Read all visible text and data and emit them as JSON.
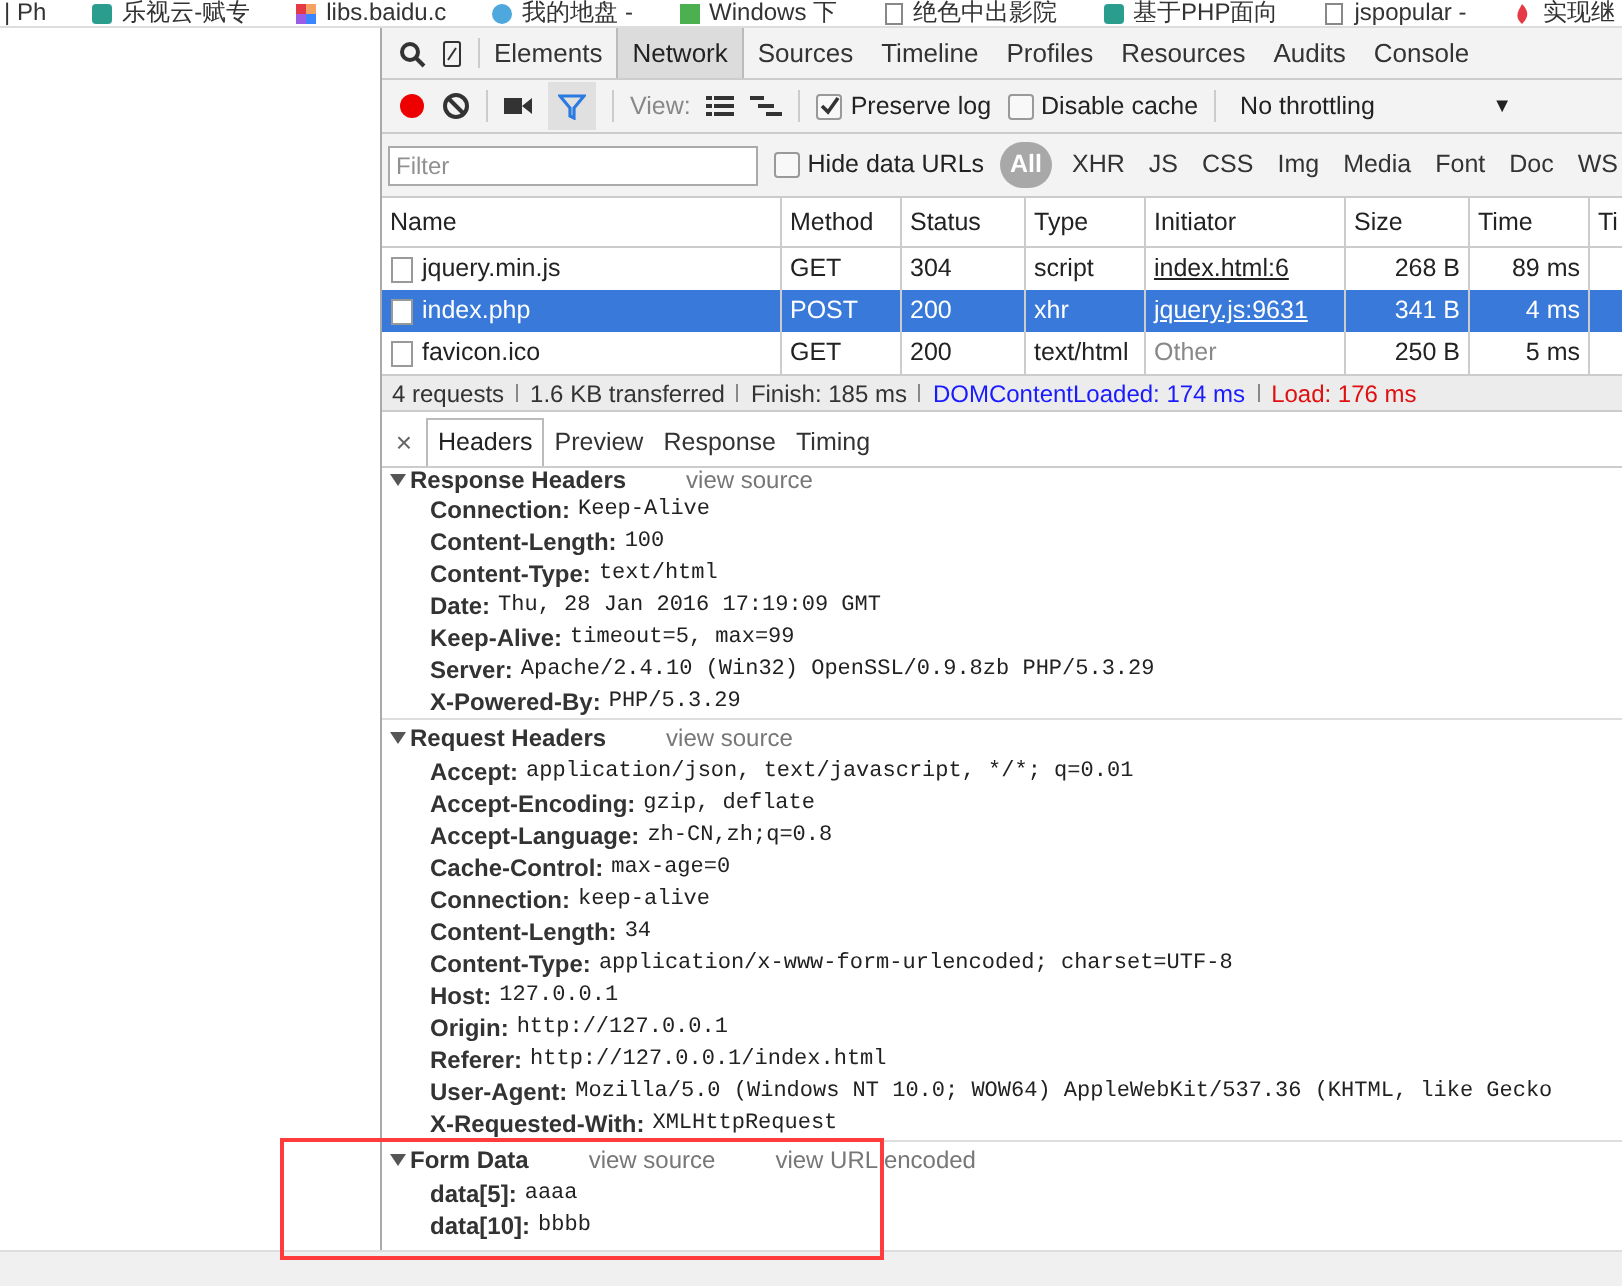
{
  "bookmarks": [
    {
      "label": "| Ph"
    },
    {
      "label": "乐视云-赋专"
    },
    {
      "label": "libs.baidu.c"
    },
    {
      "label": "我的地盘 -"
    },
    {
      "label": "Windows 下"
    },
    {
      "label": "绝色中出影院"
    },
    {
      "label": "基于PHP面向"
    },
    {
      "label": "jspopular -"
    },
    {
      "label": "实现继"
    }
  ],
  "panel_tabs": [
    {
      "label": "Elements",
      "selected": false
    },
    {
      "label": "Network",
      "selected": true
    },
    {
      "label": "Sources",
      "selected": false
    },
    {
      "label": "Timeline",
      "selected": false
    },
    {
      "label": "Profiles",
      "selected": false
    },
    {
      "label": "Resources",
      "selected": false
    },
    {
      "label": "Audits",
      "selected": false
    },
    {
      "label": "Console",
      "selected": false
    }
  ],
  "toolbar": {
    "recording": true,
    "filter_on": true,
    "view_label": "View:",
    "preserve_log": {
      "label": "Preserve log",
      "checked": true
    },
    "disable_cache": {
      "label": "Disable cache",
      "checked": false
    },
    "throttling": "No throttling",
    "throttle_caret": "▼"
  },
  "filter_bar": {
    "placeholder": "Filter",
    "hide_data_urls": {
      "label": "Hide data URLs",
      "checked": false
    },
    "types": [
      {
        "label": "All",
        "selected": true
      },
      {
        "label": "XHR",
        "selected": false
      },
      {
        "label": "JS",
        "selected": false
      },
      {
        "label": "CSS",
        "selected": false
      },
      {
        "label": "Img",
        "selected": false
      },
      {
        "label": "Media",
        "selected": false
      },
      {
        "label": "Font",
        "selected": false
      },
      {
        "label": "Doc",
        "selected": false
      },
      {
        "label": "WS",
        "selected": false
      }
    ]
  },
  "table": {
    "columns": [
      "Name",
      "Method",
      "Status",
      "Type",
      "Initiator",
      "Size",
      "Time",
      "Ti"
    ],
    "rows": [
      {
        "name": "jquery.min.js",
        "method": "GET",
        "status": "304",
        "type": "script",
        "initiator": "index.html:6",
        "initiator_link": true,
        "size": "268 B",
        "time": "89 ms",
        "selected": false
      },
      {
        "name": "index.php",
        "method": "POST",
        "status": "200",
        "type": "xhr",
        "initiator": "jquery.js:9631",
        "initiator_link": true,
        "size": "341 B",
        "time": "4 ms",
        "selected": true
      },
      {
        "name": "favicon.ico",
        "method": "GET",
        "status": "200",
        "type": "text/html",
        "initiator": "Other",
        "initiator_link": false,
        "size": "250 B",
        "time": "5 ms",
        "selected": false
      }
    ]
  },
  "summary": [
    {
      "text": "4 requests",
      "kind": "plain"
    },
    {
      "text": "1.6 KB transferred",
      "kind": "plain"
    },
    {
      "text": "Finish: 185 ms",
      "kind": "plain"
    },
    {
      "text": "DOMContentLoaded: 174 ms",
      "kind": "dom"
    },
    {
      "text": "Load: 176 ms",
      "kind": "load"
    }
  ],
  "detail": {
    "close": "×",
    "tabs": [
      {
        "label": "Headers",
        "selected": true
      },
      {
        "label": "Preview",
        "selected": false
      },
      {
        "label": "Response",
        "selected": false
      },
      {
        "label": "Timing",
        "selected": false
      }
    ],
    "sections": [
      {
        "title": "Response Headers",
        "links": [
          "view source"
        ],
        "expanded": true,
        "headers": [
          {
            "name": "Connection:",
            "value": "Keep-Alive"
          },
          {
            "name": "Content-Length:",
            "value": "100"
          },
          {
            "name": "Content-Type:",
            "value": "text/html"
          },
          {
            "name": "Date:",
            "value": "Thu, 28 Jan 2016 17:19:09 GMT"
          },
          {
            "name": "Keep-Alive:",
            "value": "timeout=5, max=99"
          },
          {
            "name": "Server:",
            "value": "Apache/2.4.10 (Win32) OpenSSL/0.9.8zb PHP/5.3.29"
          },
          {
            "name": "X-Powered-By:",
            "value": "PHP/5.3.29"
          }
        ]
      },
      {
        "title": "Request Headers",
        "links": [
          "view source"
        ],
        "expanded": true,
        "headers": [
          {
            "name": "Accept:",
            "value": "application/json, text/javascript, */*; q=0.01"
          },
          {
            "name": "Accept-Encoding:",
            "value": "gzip, deflate"
          },
          {
            "name": "Accept-Language:",
            "value": "zh-CN,zh;q=0.8"
          },
          {
            "name": "Cache-Control:",
            "value": "max-age=0"
          },
          {
            "name": "Connection:",
            "value": "keep-alive"
          },
          {
            "name": "Content-Length:",
            "value": "34"
          },
          {
            "name": "Content-Type:",
            "value": "application/x-www-form-urlencoded; charset=UTF-8"
          },
          {
            "name": "Host:",
            "value": "127.0.0.1"
          },
          {
            "name": "Origin:",
            "value": "http://127.0.0.1"
          },
          {
            "name": "Referer:",
            "value": "http://127.0.0.1/index.html"
          },
          {
            "name": "User-Agent:",
            "value": "Mozilla/5.0 (Windows NT 10.0; WOW64) AppleWebKit/537.36 (KHTML, like Gecko"
          },
          {
            "name": "X-Requested-With:",
            "value": "XMLHttpRequest"
          }
        ]
      },
      {
        "title": "Form Data",
        "links": [
          "view source",
          "view URL encoded"
        ],
        "expanded": true,
        "highlighted": true,
        "headers": [
          {
            "name": "data[5]:",
            "value": "aaaa"
          },
          {
            "name": "data[10]:",
            "value": "bbbb"
          }
        ]
      }
    ]
  }
}
